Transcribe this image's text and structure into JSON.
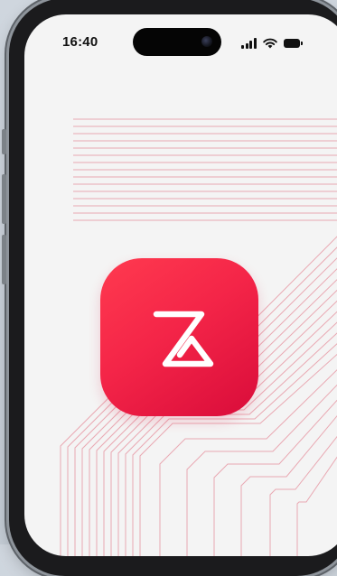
{
  "status_bar": {
    "time": "16:40",
    "icons": [
      "cellular-signal-icon",
      "wifi-icon",
      "battery-icon"
    ]
  },
  "app_icon": {
    "logo": "zomato-z-logo-icon",
    "background_color": "#f42548",
    "glyph_color": "#ffffff"
  },
  "background": {
    "line_color": "#e9a8b2",
    "screen_color": "#f4f4f4"
  }
}
